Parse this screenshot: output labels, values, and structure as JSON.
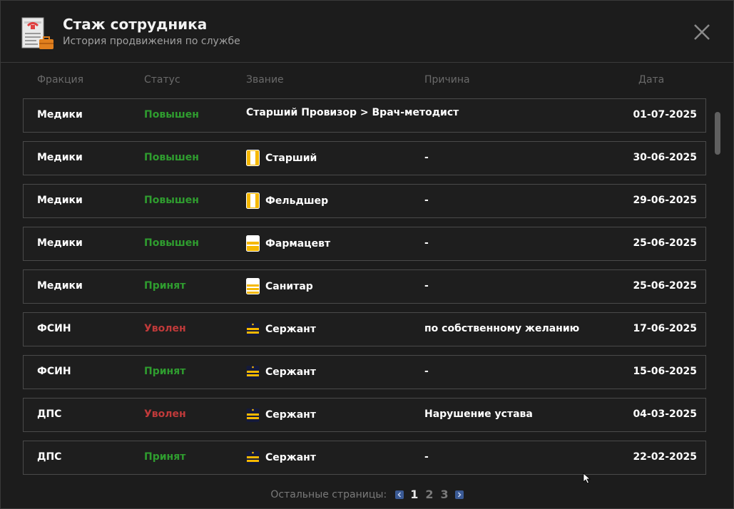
{
  "header": {
    "title": "Стаж сотрудника",
    "subtitle": "История продвижения по службе",
    "logo_icon": "service-record-document-icon",
    "close_icon": "close-icon"
  },
  "columns": {
    "faction": "Фракция",
    "status": "Статус",
    "rank": "Звание",
    "reason": "Причина",
    "date": "Дата"
  },
  "colors": {
    "promoted": "#2f9d2f",
    "hired": "#2f9d2f",
    "fired": "#c03a3a",
    "rank_icon": "#f5b800"
  },
  "rows": [
    {
      "faction": "Медики",
      "status": "Повышен",
      "status_type": "promoted",
      "rank": "Старший Провизор > Врач-методист",
      "rank_icon": "",
      "reason": "",
      "date": "01-07-2025"
    },
    {
      "faction": "Медики",
      "status": "Повышен",
      "status_type": "promoted",
      "rank": "Старший",
      "rank_icon": "medic-stripe-icon",
      "reason": "-",
      "date": "30-06-2025"
    },
    {
      "faction": "Медики",
      "status": "Повышен",
      "status_type": "promoted",
      "rank": "Фельдшер",
      "rank_icon": "medic-stripe-icon",
      "reason": "-",
      "date": "29-06-2025"
    },
    {
      "faction": "Медики",
      "status": "Повышен",
      "status_type": "promoted",
      "rank": "Фармацевт",
      "rank_icon": "medic-epaulette-icon",
      "reason": "-",
      "date": "25-06-2025"
    },
    {
      "faction": "Медики",
      "status": "Принят",
      "status_type": "hired",
      "rank": "Санитар",
      "rank_icon": "medic-epaulette-icon",
      "reason": "-",
      "date": "25-06-2025"
    },
    {
      "faction": "ФСИН",
      "status": "Уволен",
      "status_type": "fired",
      "rank": "Сержант",
      "rank_icon": "sergeant-epaulette-icon",
      "reason": "по собственному желанию",
      "date": "17-06-2025"
    },
    {
      "faction": "ФСИН",
      "status": "Принят",
      "status_type": "hired",
      "rank": "Сержант",
      "rank_icon": "sergeant-epaulette-icon",
      "reason": "-",
      "date": "15-06-2025"
    },
    {
      "faction": "ДПС",
      "status": "Уволен",
      "status_type": "fired",
      "rank": "Сержант",
      "rank_icon": "sergeant-epaulette-icon",
      "reason": "Нарушение устава",
      "date": "04-03-2025"
    },
    {
      "faction": "ДПС",
      "status": "Принят",
      "status_type": "hired",
      "rank": "Сержант",
      "rank_icon": "sergeant-epaulette-icon",
      "reason": "-",
      "date": "22-02-2025"
    }
  ],
  "pagination": {
    "label": "Остальные страницы:",
    "pages": [
      "1",
      "2",
      "3"
    ],
    "current": "1",
    "prev_icon": "chevron-left-icon",
    "next_icon": "chevron-right-icon"
  }
}
